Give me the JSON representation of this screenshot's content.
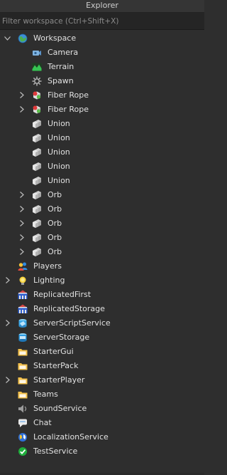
{
  "panel": {
    "title": "Explorer"
  },
  "filter": {
    "placeholder": "Filter workspace (Ctrl+Shift+X)"
  },
  "tree": [
    {
      "label": "Workspace",
      "icon": "workspace",
      "expander": "expanded",
      "depth": 0
    },
    {
      "label": "Camera",
      "icon": "camera",
      "expander": "none",
      "depth": 1
    },
    {
      "label": "Terrain",
      "icon": "terrain",
      "expander": "none",
      "depth": 1
    },
    {
      "label": "Spawn",
      "icon": "spawn",
      "expander": "none",
      "depth": 1
    },
    {
      "label": "Fiber Rope",
      "icon": "model",
      "expander": "collapsed",
      "depth": 1
    },
    {
      "label": "Fiber Rope",
      "icon": "model",
      "expander": "collapsed",
      "depth": 1
    },
    {
      "label": "Union",
      "icon": "union",
      "expander": "none",
      "depth": 1
    },
    {
      "label": "Union",
      "icon": "union",
      "expander": "none",
      "depth": 1
    },
    {
      "label": "Union",
      "icon": "union",
      "expander": "none",
      "depth": 1
    },
    {
      "label": "Union",
      "icon": "union",
      "expander": "none",
      "depth": 1
    },
    {
      "label": "Union",
      "icon": "union",
      "expander": "none",
      "depth": 1
    },
    {
      "label": "Orb",
      "icon": "union",
      "expander": "collapsed",
      "depth": 1
    },
    {
      "label": "Orb",
      "icon": "union",
      "expander": "collapsed",
      "depth": 1
    },
    {
      "label": "Orb",
      "icon": "union",
      "expander": "collapsed",
      "depth": 1
    },
    {
      "label": "Orb",
      "icon": "union",
      "expander": "collapsed",
      "depth": 1
    },
    {
      "label": "Orb",
      "icon": "union",
      "expander": "collapsed",
      "depth": 1
    },
    {
      "label": "Players",
      "icon": "players",
      "expander": "none",
      "depth": 0
    },
    {
      "label": "Lighting",
      "icon": "lighting",
      "expander": "collapsed",
      "depth": 0
    },
    {
      "label": "ReplicatedFirst",
      "icon": "replicated",
      "expander": "none",
      "depth": 0
    },
    {
      "label": "ReplicatedStorage",
      "icon": "replicated",
      "expander": "none",
      "depth": 0
    },
    {
      "label": "ServerScriptService",
      "icon": "server-script",
      "expander": "collapsed",
      "depth": 0
    },
    {
      "label": "ServerStorage",
      "icon": "server-storage",
      "expander": "none",
      "depth": 0
    },
    {
      "label": "StarterGui",
      "icon": "folder",
      "expander": "none",
      "depth": 0
    },
    {
      "label": "StarterPack",
      "icon": "folder",
      "expander": "none",
      "depth": 0
    },
    {
      "label": "StarterPlayer",
      "icon": "folder",
      "expander": "collapsed",
      "depth": 0
    },
    {
      "label": "Teams",
      "icon": "folder",
      "expander": "none",
      "depth": 0
    },
    {
      "label": "SoundService",
      "icon": "sound",
      "expander": "none",
      "depth": 0
    },
    {
      "label": "Chat",
      "icon": "chat",
      "expander": "none",
      "depth": 0
    },
    {
      "label": "LocalizationService",
      "icon": "localization",
      "expander": "none",
      "depth": 0
    },
    {
      "label": "TestService",
      "icon": "test",
      "expander": "none",
      "depth": 0
    }
  ]
}
